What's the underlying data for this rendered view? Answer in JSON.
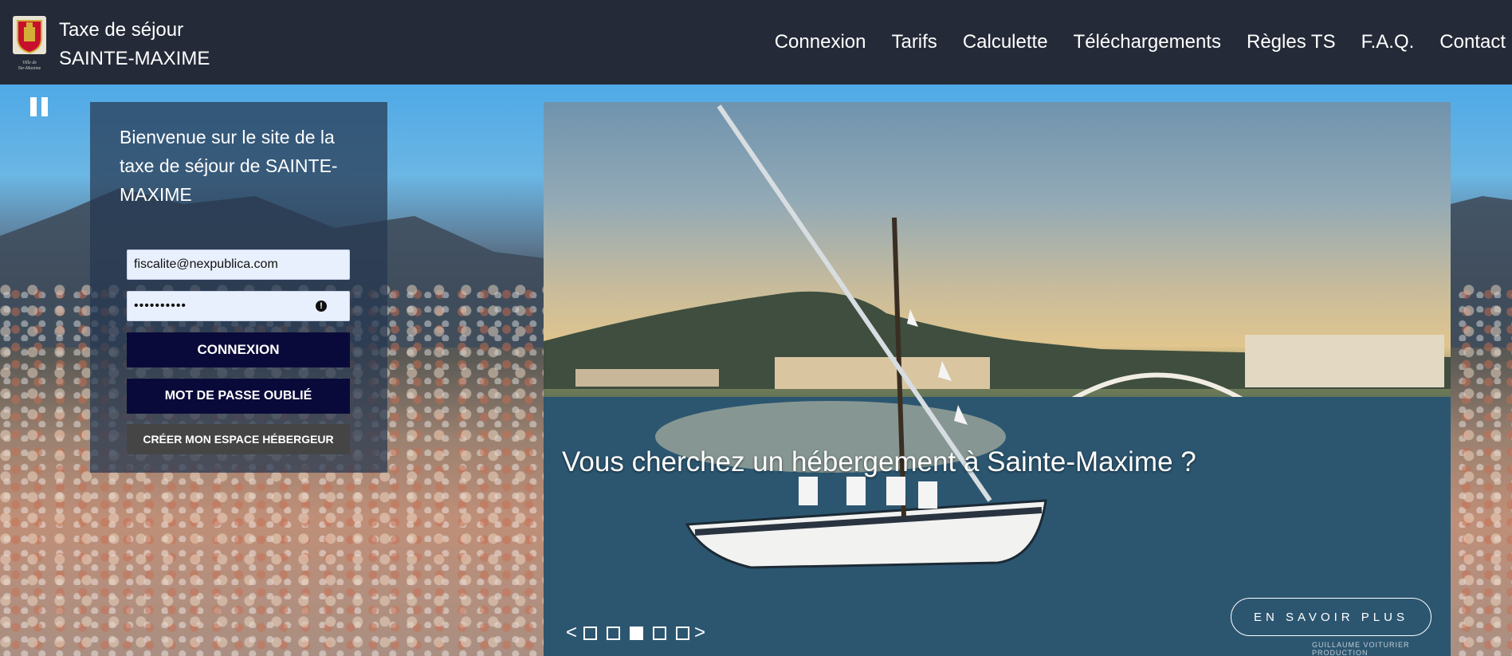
{
  "header": {
    "title_line1": "Taxe de séjour",
    "title_line2": "SAINTE-MAXIME",
    "nav": [
      {
        "label": "Connexion"
      },
      {
        "label": "Tarifs"
      },
      {
        "label": "Calculette"
      },
      {
        "label": "Téléchargements"
      },
      {
        "label": "Règles TS"
      },
      {
        "label": "F.A.Q."
      },
      {
        "label": "Contact"
      }
    ]
  },
  "login": {
    "welcome": "Bienvenue sur le site de la taxe de séjour de SAINTE-MAXIME",
    "email_value": "fiscalite@nexpublica.com",
    "password_value": "••••••••••",
    "login_label": "CONNEXION",
    "forgot_label": "MOT DE PASSE OUBLIÉ",
    "create_label": "CRÉER MON ESPACE HÉBERGEUR"
  },
  "carousel": {
    "caption": "Vous cherchez un hébergement à Sainte-Maxime ?",
    "learn_more": "EN SAVOIR PLUS",
    "prev": "<",
    "next": ">",
    "slides": 5,
    "active_slide": 3,
    "photo_credit": "GUILLAUME VOITURIER PRODUCTION"
  },
  "colors": {
    "header_bg": "#242a37",
    "button_dark": "#0a0a3a",
    "button_grey": "#454545"
  }
}
